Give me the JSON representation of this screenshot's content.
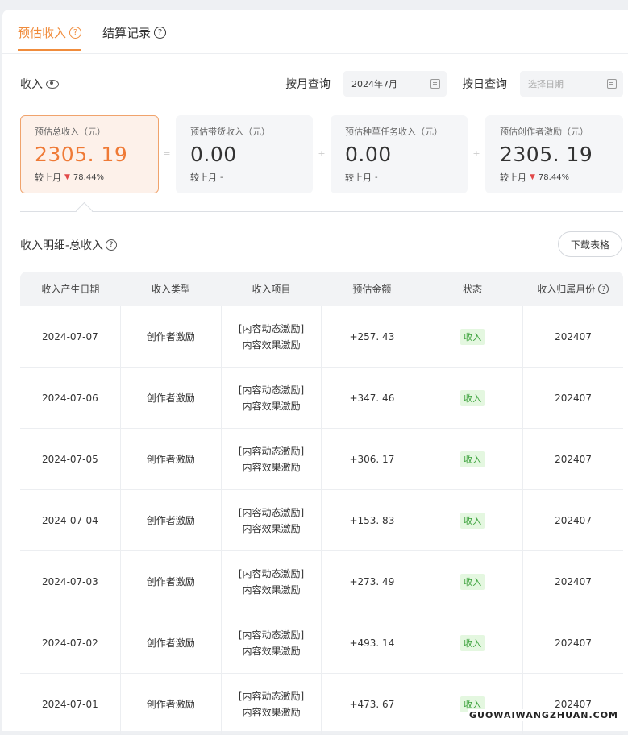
{
  "tabs": [
    {
      "label": "预估收入"
    },
    {
      "label": "结算记录"
    }
  ],
  "income": {
    "label": "收入",
    "month_query_label": "按月查询",
    "month_value": "2024年7月",
    "day_query_label": "按日查询",
    "day_placeholder": "选择日期"
  },
  "cards": [
    {
      "title": "预估总收入（元）",
      "value": "2305. 19",
      "compare_label": "较上月",
      "compare_pct": "78.44%"
    },
    {
      "title": "预估带货收入（元）",
      "value": "0.00",
      "compare_label": "较上月",
      "compare_pct": "-"
    },
    {
      "title": "预估种草任务收入（元）",
      "value": "0.00",
      "compare_label": "较上月",
      "compare_pct": "-"
    },
    {
      "title": "预估创作者激励（元）",
      "value": "2305. 19",
      "compare_label": "较上月",
      "compare_pct": "78.44%"
    }
  ],
  "operators": [
    "=",
    "+",
    "+"
  ],
  "detail": {
    "title": "收入明细-总收入",
    "download_label": "下载表格"
  },
  "table": {
    "headers": [
      "收入产生日期",
      "收入类型",
      "收入项目",
      "预估金额",
      "状态",
      "收入归属月份"
    ],
    "rows": [
      {
        "date": "2024-07-07",
        "type": "创作者激励",
        "item1": "[内容动态激励]",
        "item2": "内容效果激励",
        "amount": "+257. 43",
        "status": "收入",
        "month": "202407"
      },
      {
        "date": "2024-07-06",
        "type": "创作者激励",
        "item1": "[内容动态激励]",
        "item2": "内容效果激励",
        "amount": "+347. 46",
        "status": "收入",
        "month": "202407"
      },
      {
        "date": "2024-07-05",
        "type": "创作者激励",
        "item1": "[内容动态激励]",
        "item2": "内容效果激励",
        "amount": "+306. 17",
        "status": "收入",
        "month": "202407"
      },
      {
        "date": "2024-07-04",
        "type": "创作者激励",
        "item1": "[内容动态激励]",
        "item2": "内容效果激励",
        "amount": "+153. 83",
        "status": "收入",
        "month": "202407"
      },
      {
        "date": "2024-07-03",
        "type": "创作者激励",
        "item1": "[内容动态激励]",
        "item2": "内容效果激励",
        "amount": "+273. 49",
        "status": "收入",
        "month": "202407"
      },
      {
        "date": "2024-07-02",
        "type": "创作者激励",
        "item1": "[内容动态激励]",
        "item2": "内容效果激励",
        "amount": "+493. 14",
        "status": "收入",
        "month": "202407"
      },
      {
        "date": "2024-07-01",
        "type": "创作者激励",
        "item1": "[内容动态激励]",
        "item2": "内容效果激励",
        "amount": "+473. 67",
        "status": "收入",
        "month": "202407"
      }
    ]
  },
  "watermark": "GUOWAIWANGZHUAN.COM",
  "colors": {
    "accent": "#f08c3c",
    "status_bg": "#e4f7e0",
    "status_text": "#3aa13a",
    "down": "#e24a4a"
  }
}
